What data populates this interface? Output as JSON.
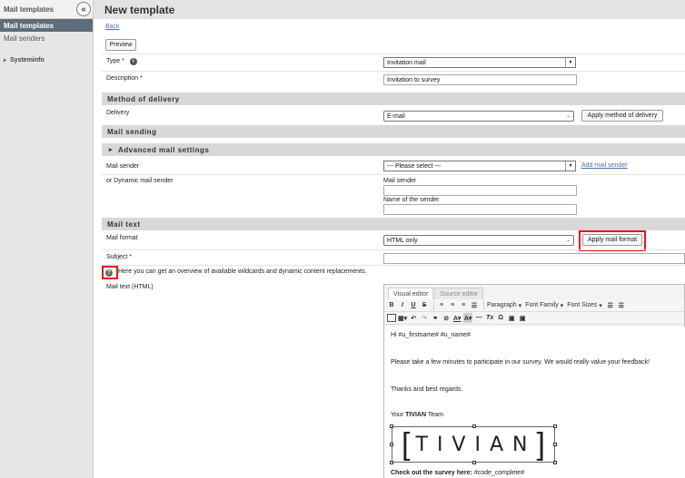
{
  "sidebar": {
    "header": "Mail templates",
    "collapse_icon": "«",
    "items": [
      {
        "label": "Mail templates",
        "active": true
      },
      {
        "label": "Mail senders",
        "active": false
      }
    ],
    "tree_item": "Systeminfo"
  },
  "page": {
    "title": "New template",
    "back_link": "Back",
    "preview_button": "Preview"
  },
  "form": {
    "type_label": "Type *",
    "type_value": "Invitation mail",
    "description_label": "Description *",
    "description_value": "Invitation to survey",
    "section_delivery": "Method of delivery",
    "delivery_label": "Delivery",
    "delivery_value": "E-mail",
    "apply_delivery_button": "Apply method of delivery",
    "section_sending": "Mail sending",
    "section_advanced": "Advanced mail settings",
    "mail_sender_label": "Mail sender",
    "mail_sender_value": "--- Please select ---",
    "add_sender_link": "Add mail sender",
    "dynamic_sender_label": "or Dynamic mail sender",
    "dyn_mail_sender_label": "Mail sender",
    "dyn_sender_name_label": "Name of the sender",
    "section_mail_text": "Mail text",
    "mail_format_label": "Mail format",
    "mail_format_value": "HTML only",
    "apply_format_button": "Apply mail format",
    "subject_label": "Subject *",
    "wildcards_text": "Here you can get an overview of available wildcards and dynamic content replacements.",
    "mail_text_label": "Mail text (HTML)"
  },
  "editor": {
    "tabs": [
      "Visual editor",
      "Source editor"
    ],
    "paragraph_dd": "Paragraph",
    "font_family_dd": "Font Family",
    "font_sizes_dd": "Font Sizes",
    "body": {
      "greeting": "Hi #u_firstname# #u_name#",
      "paragraph1": "Please take a few minutes to participate in our survey. We would really value your feedback!",
      "closing": "Thanks and best regards.",
      "signature_prefix": "Your ",
      "signature_brand": "TIVIAN",
      "signature_suffix": " Team",
      "logo_text": "TIVIAN",
      "cta_bold": "Check out the survey here:",
      "cta_code": " #code_complete#"
    }
  },
  "colors": {
    "highlight": "#e0181a",
    "sidebar_active": "#5f6d7a",
    "link": "#4a6fa5"
  }
}
